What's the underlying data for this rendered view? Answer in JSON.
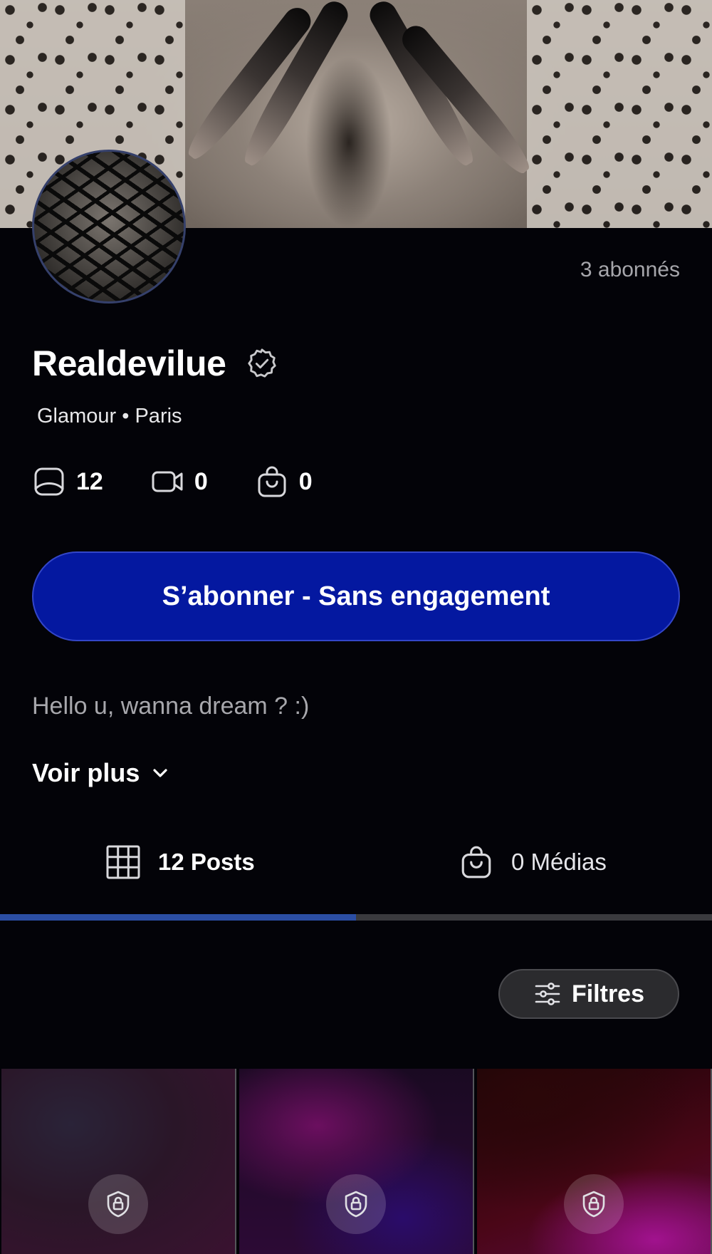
{
  "profile": {
    "subscribers": "3 abonnés",
    "name": "Realdevilue",
    "meta": "Glamour • Paris",
    "stats": {
      "photos": "12",
      "videos": "0",
      "products": "0"
    },
    "subscribe_label": "S’abonner - Sans engagement",
    "bio": "Hello u, wanna dream ? :)",
    "see_more_label": "Voir plus"
  },
  "tabs": [
    {
      "label": "12 Posts",
      "active": true,
      "icon": "grid-icon"
    },
    {
      "label": "0 Médias",
      "active": false,
      "icon": "shopping-bag-icon"
    }
  ],
  "filters_label": "Filtres",
  "colors": {
    "background": "#030308",
    "accent_button": "#0418a0",
    "tab_indicator": "#2b4ea4",
    "muted_text": "#a6a6ab"
  },
  "posts": [
    {
      "locked": true,
      "icon": "lock-icon"
    },
    {
      "locked": true,
      "icon": "lock-icon"
    },
    {
      "locked": true,
      "icon": "lock-icon"
    }
  ]
}
